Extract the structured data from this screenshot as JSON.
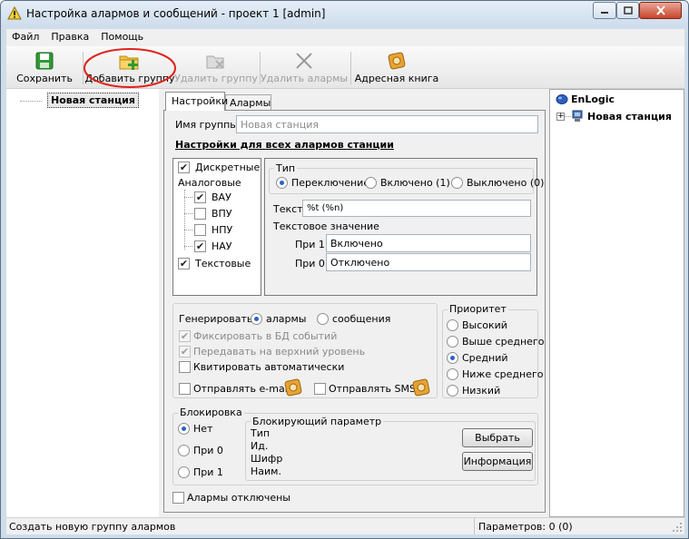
{
  "window": {
    "title": "Настройка алармов и сообщений - проект 1 [admin]"
  },
  "menu": [
    "Файл",
    "Правка",
    "Помощь"
  ],
  "toolbar": {
    "save": "Сохранить",
    "add_group": "Добавить группу",
    "delete_group": "Удалить группу",
    "delete_alarms": "Удалить алармы",
    "address_book": "Адресная книга"
  },
  "left_tree": {
    "station": "Новая станция"
  },
  "tabs": [
    "Настройки",
    "Алармы"
  ],
  "settings": {
    "group_name_label": "Имя группы",
    "group_name_placeholder": "Новая станция",
    "all_alarms_header": "Настройки для всех алармов станции",
    "filters": {
      "discrete": "Дискретные",
      "analog": "Аналоговые",
      "analog_items": [
        "ВАУ",
        "ВПУ",
        "НПУ",
        "НАУ"
      ],
      "text": "Текстовые"
    },
    "type": {
      "legend": "Тип",
      "options": [
        "Переключение",
        "Включено (1)",
        "Выключено (0)"
      ],
      "text_label": "Текст",
      "text_value": "%t (%n)",
      "text_value_label": "Текстовое значение",
      "at1_label": "При 1",
      "at1_value": "Включено",
      "at0_label": "При 0",
      "at0_value": "Отключено"
    },
    "generate": {
      "label": "Генерировать",
      "alarms": "алармы",
      "messages": "сообщения",
      "fix_db": "Фиксировать в БД событий",
      "pass_up": "Передавать на верхний уровень",
      "ack_auto": "Квитировать автоматически",
      "send_email": "Отправлять e-mail",
      "send_sms": "Отправлять SMS"
    },
    "priority": {
      "legend": "Приоритет",
      "options": [
        "Высокий",
        "Выше среднего",
        "Средний",
        "Ниже среднего",
        "Низкий"
      ]
    },
    "blocking": {
      "legend": "Блокировка",
      "options": [
        "Нет",
        "При 0",
        "При 1"
      ],
      "param_legend": "Блокирующий параметр",
      "fields": [
        "Тип",
        "Ид.",
        "Шифр",
        "Наим."
      ],
      "select_button": "Выбрать",
      "info_button": "Информация"
    },
    "alarms_disabled": "Алармы отключены"
  },
  "right_tree": {
    "root": "EnLogic",
    "station": "Новая станция"
  },
  "status": {
    "left": "Создать новую группу алармов",
    "right": "Параметров: 0 (0)"
  }
}
